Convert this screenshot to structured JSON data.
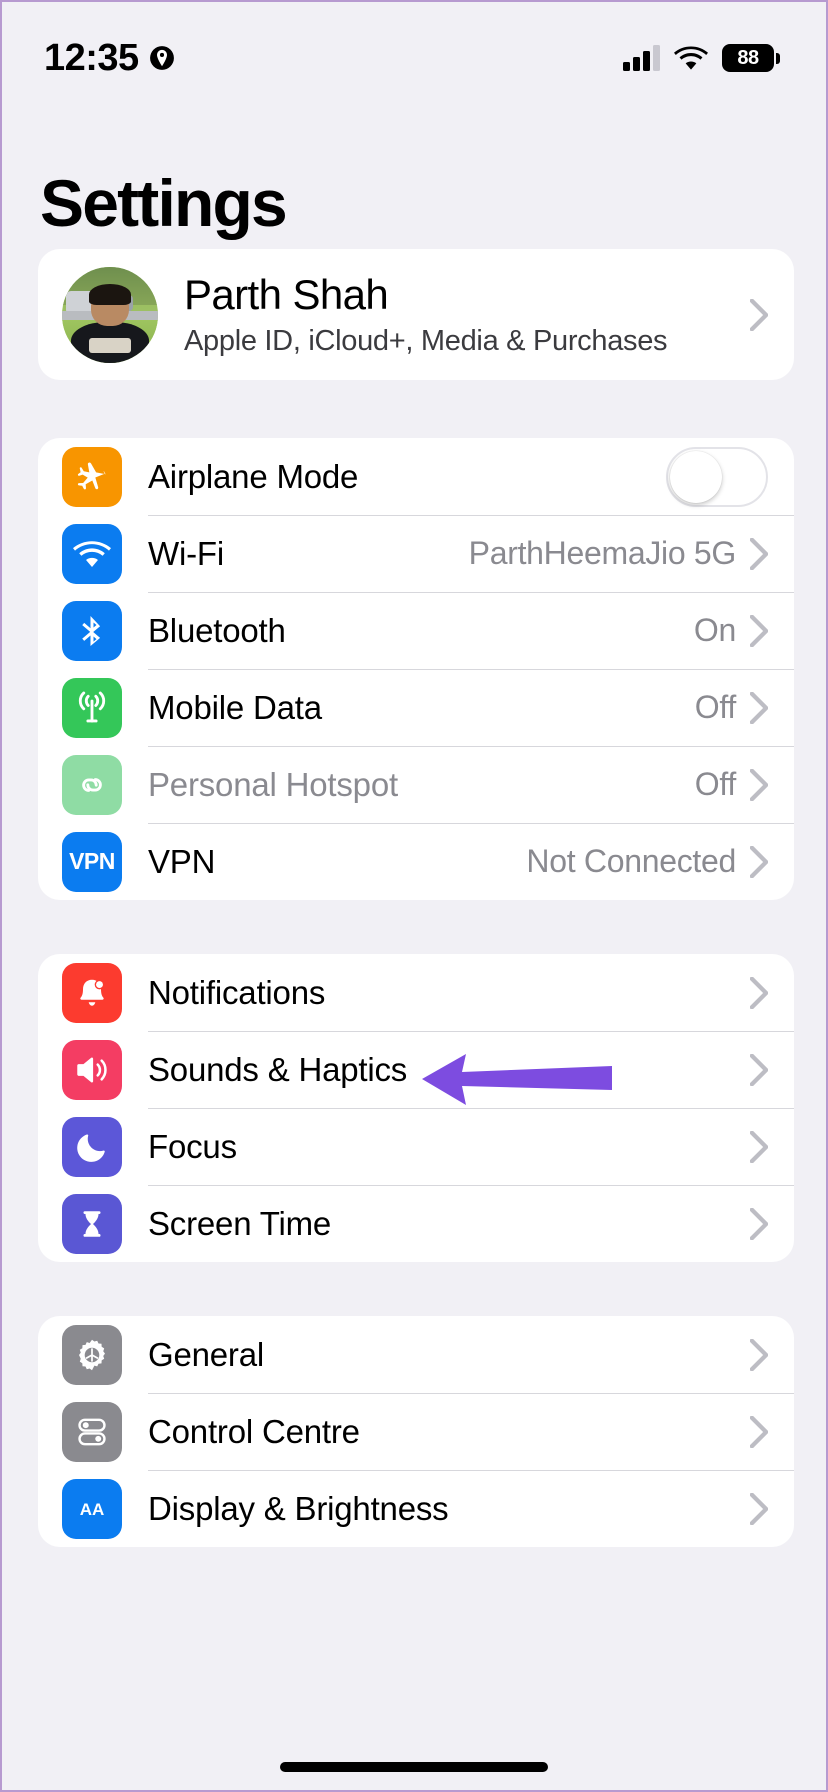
{
  "status_bar": {
    "time": "12:35",
    "location_icon": "location-services-icon",
    "signal_icon": "cellular-signal-icon",
    "wifi_icon": "wifi-icon",
    "battery_level": "88"
  },
  "page_title": "Settings",
  "account": {
    "name": "Parth Shah",
    "subtitle": "Apple ID, iCloud+, Media & Purchases",
    "avatar": "user-avatar-photo",
    "chevron": "chevron-right-icon"
  },
  "annotation": {
    "type": "arrow-pointer",
    "color": "#7d4ce0",
    "points_to": "Sounds & Haptics"
  },
  "colors": {
    "background": "#f1f0f5",
    "card": "#ffffff",
    "separator": "#d7d7dc",
    "secondary_text": "#8a8a90",
    "orange": "#f89500",
    "blue": "#0b7cf0",
    "green": "#34c759",
    "green_dim": "#8fdca4",
    "red": "#fc3b2f",
    "pink": "#f43d63",
    "indigo": "#5a57d4",
    "purple": "#5c57d8",
    "gray": "#8a8a8f",
    "vpn_blue": "#0b7cf0"
  },
  "groups": [
    {
      "name": "connectivity",
      "rows": [
        {
          "label": "Airplane Mode",
          "icon": "airplane-icon",
          "icon_color": "#f89500",
          "control": "toggle",
          "toggle_on": false
        },
        {
          "label": "Wi-Fi",
          "icon": "wifi-icon",
          "icon_color": "#0b7cf0",
          "value": "ParthHeemaJio 5G",
          "control": "chevron"
        },
        {
          "label": "Bluetooth",
          "icon": "bluetooth-icon",
          "icon_color": "#0b7cf0",
          "value": "On",
          "control": "chevron"
        },
        {
          "label": "Mobile Data",
          "icon": "cellular-antenna-icon",
          "icon_color": "#34c759",
          "value": "Off",
          "control": "chevron"
        },
        {
          "label": "Personal Hotspot",
          "icon": "hotspot-link-icon",
          "icon_color": "#8fdca4",
          "value": "Off",
          "control": "chevron",
          "disabled": true
        },
        {
          "label": "VPN",
          "icon": "vpn-icon",
          "icon_color": "#0b7cf0",
          "value": "Not Connected",
          "control": "chevron"
        }
      ]
    },
    {
      "name": "alerts",
      "rows": [
        {
          "label": "Notifications",
          "icon": "notification-bell-icon",
          "icon_color": "#fc3b2f",
          "control": "chevron"
        },
        {
          "label": "Sounds & Haptics",
          "icon": "speaker-waves-icon",
          "icon_color": "#f43d63",
          "control": "chevron"
        },
        {
          "label": "Focus",
          "icon": "moon-icon",
          "icon_color": "#5c57d8",
          "control": "chevron"
        },
        {
          "label": "Screen Time",
          "icon": "hourglass-icon",
          "icon_color": "#5a57d4",
          "control": "chevron"
        }
      ]
    },
    {
      "name": "system",
      "rows": [
        {
          "label": "General",
          "icon": "gear-icon",
          "icon_color": "#8a8a8f",
          "control": "chevron"
        },
        {
          "label": "Control Centre",
          "icon": "control-centre-icon",
          "icon_color": "#8a8a8f",
          "control": "chevron"
        },
        {
          "label": "Display & Brightness",
          "icon": "display-brightness-icon",
          "icon_color": "#0b7cf0",
          "control": "chevron"
        }
      ]
    }
  ]
}
